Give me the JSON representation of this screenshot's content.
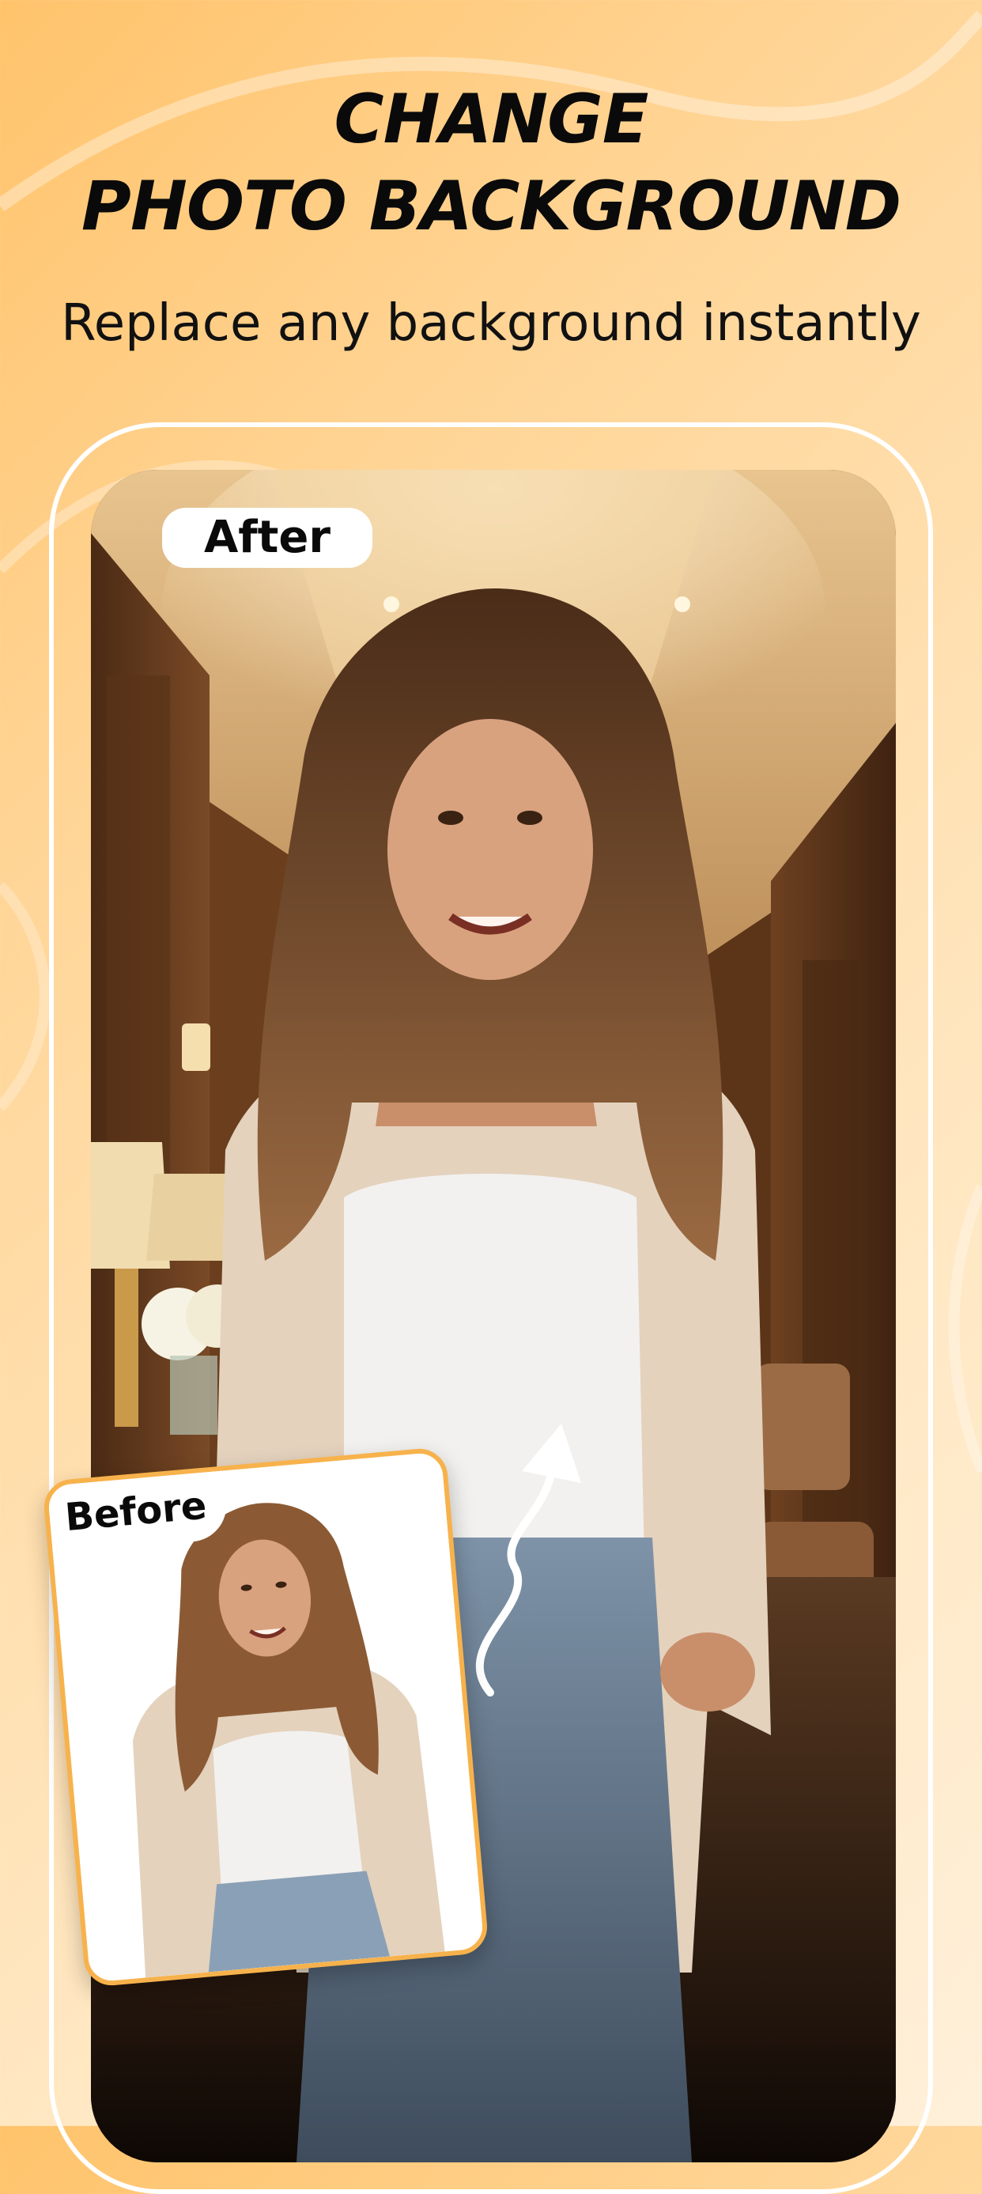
{
  "headline": {
    "line1": "CHANGE",
    "line2": "PHOTO BACKGROUND"
  },
  "subtitle": "Replace any background instantly",
  "after_label": "After",
  "before_label": "Before",
  "colors": {
    "accent": "#f7b24c",
    "background_start": "#ffc36b",
    "background_end": "#fff0da",
    "text": "#0a0a0a"
  },
  "icons": [
    "curved-arrow-icon"
  ]
}
